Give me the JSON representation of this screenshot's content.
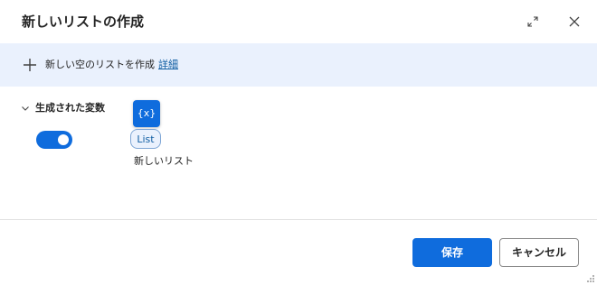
{
  "dialog": {
    "title": "新しいリストの作成"
  },
  "banner": {
    "text": "新しい空のリストを作成",
    "link": "詳細"
  },
  "variables_section": {
    "label": "生成された変数",
    "toggle_on": true,
    "variable": {
      "icon_text": "{x}",
      "type": "List",
      "name": "新しいリスト"
    }
  },
  "footer": {
    "save_label": "保存",
    "cancel_label": "キャンセル"
  },
  "colors": {
    "accent": "#0f6cdd",
    "banner_bg": "#eaf1fd",
    "link": "#115ea3"
  },
  "icons": [
    "expand-icon",
    "close-icon",
    "plus-icon",
    "chevron-down-icon",
    "variable-icon",
    "resize-grip-icon"
  ]
}
